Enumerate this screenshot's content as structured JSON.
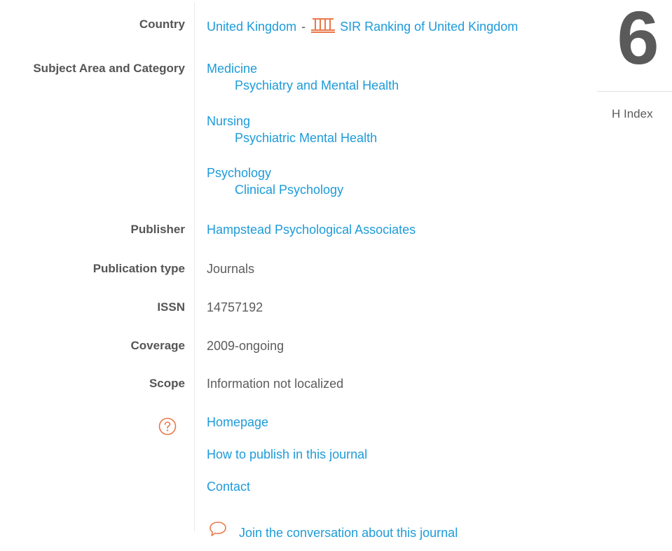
{
  "labels": {
    "country": "Country",
    "subject_area": "Subject Area and Category",
    "publisher": "Publisher",
    "publication_type": "Publication type",
    "issn": "ISSN",
    "coverage": "Coverage",
    "scope": "Scope"
  },
  "country": {
    "name": "United Kingdom",
    "separator": "-",
    "sir_link": "SIR Ranking of United Kingdom",
    "sir_icon": "sir-ranking-icon",
    "accent_color": "#e8784a"
  },
  "subjects": [
    {
      "area": "Medicine",
      "category": "Psychiatry and Mental Health"
    },
    {
      "area": "Nursing",
      "category": "Psychiatric Mental Health"
    },
    {
      "area": "Psychology",
      "category": "Clinical Psychology"
    }
  ],
  "publisher": "Hampstead Psychological Associates",
  "publication_type": "Journals",
  "issn": "14757192",
  "coverage": "2009-ongoing",
  "scope": "Information not localized",
  "links": {
    "homepage": "Homepage",
    "how_to_publish": "How to publish in this journal",
    "contact": "Contact",
    "conversation": "Join the conversation about this journal"
  },
  "icons": {
    "help": "question-circle-icon",
    "chat": "chat-bubble-icon"
  },
  "h_index": {
    "value": "6",
    "label": "H Index"
  },
  "colors": {
    "link": "#1d9bd9",
    "accent": "#e8784a",
    "text": "#5c5c5c"
  }
}
